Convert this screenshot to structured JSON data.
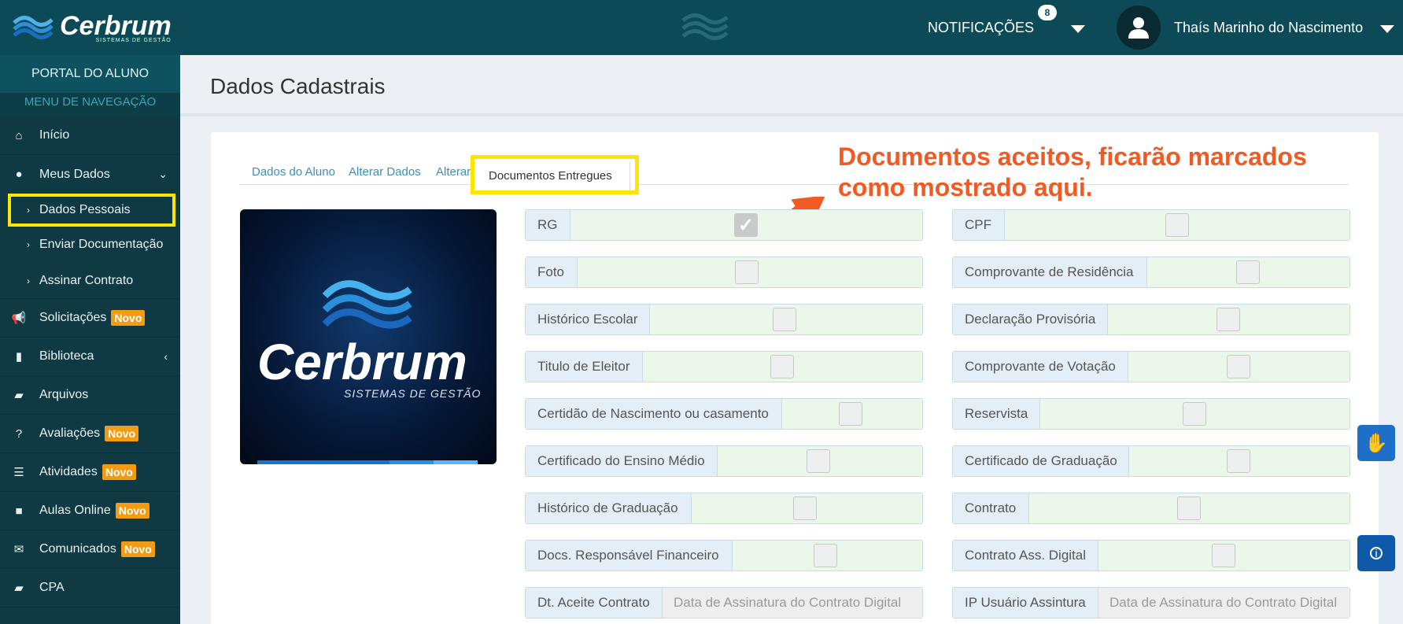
{
  "brand": {
    "name": "Cerbrum",
    "tagline": "SISTEMAS DE GESTÃO"
  },
  "sidebar": {
    "portal": "PORTAL DO ALUNO",
    "menu_header": "MENU DE NAVEGAÇÃO",
    "items": [
      {
        "label": "Início",
        "icon": "home-icon"
      },
      {
        "label": "Meus Dados",
        "icon": "user-icon"
      },
      {
        "label": "Dados Pessoais"
      },
      {
        "label": "Enviar Documentação"
      },
      {
        "label": "Assinar Contrato"
      },
      {
        "label": "Solicitações",
        "icon": "megaphone-icon",
        "badge": "Novo"
      },
      {
        "label": "Biblioteca",
        "icon": "book-icon"
      },
      {
        "label": "Arquivos",
        "icon": "folder-icon"
      },
      {
        "label": "Avaliações",
        "icon": "question-icon",
        "badge": "Novo"
      },
      {
        "label": "Atividades",
        "icon": "list-icon",
        "badge": "Novo"
      },
      {
        "label": "Aulas Online",
        "icon": "video-icon",
        "badge": "Novo"
      },
      {
        "label": "Comunicados",
        "icon": "envelope-icon",
        "badge": "Novo"
      },
      {
        "label": "CPA",
        "icon": "folder-open-icon"
      }
    ]
  },
  "topbar": {
    "notifications_label": "NOTIFICAÇÕES",
    "notifications_count": "8",
    "username": "Thaís Marinho do Nascimento"
  },
  "page": {
    "title": "Dados Cadastrais",
    "tabs": [
      "Dados do Aluno",
      "Alterar Dados",
      "Alterar Foto",
      "Documentos Entregues"
    ],
    "annotation_line1": "Documentos aceitos, ficarão marcados",
    "annotation_line2": "como mostrado aqui."
  },
  "documents": {
    "left": [
      {
        "label": "RG",
        "checked": true
      },
      {
        "label": "Foto",
        "checked": false
      },
      {
        "label": "Histórico Escolar",
        "checked": false
      },
      {
        "label": "Titulo de Eleitor",
        "checked": false
      },
      {
        "label": "Certidão de Nascimento ou casamento",
        "checked": false
      },
      {
        "label": "Certificado do Ensino Médio",
        "checked": false
      },
      {
        "label": "Histórico de Graduação",
        "checked": false
      },
      {
        "label": "Docs. Responsável Financeiro",
        "checked": false
      }
    ],
    "right": [
      {
        "label": "CPF",
        "checked": false
      },
      {
        "label": "Comprovante de Residência",
        "checked": false
      },
      {
        "label": "Declaração Provisória",
        "checked": false
      },
      {
        "label": "Comprovante de Votação",
        "checked": false
      },
      {
        "label": "Reservista",
        "checked": false
      },
      {
        "label": "Certificado de Graduação",
        "checked": false
      },
      {
        "label": "Contrato",
        "checked": false
      },
      {
        "label": "Contrato Ass. Digital",
        "checked": false
      }
    ],
    "aceite_label": "Dt. Aceite Contrato",
    "aceite_placeholder": "Data de Assinatura do Contrato Digital",
    "ip_label": "IP Usuário Assintura",
    "ip_placeholder": "Data de Assinatura do Contrato Digital"
  },
  "colors": {
    "accent": "#0b4a56",
    "highlight": "#ffe600",
    "annotation": "#f15a22",
    "badge": "#f39c12"
  }
}
